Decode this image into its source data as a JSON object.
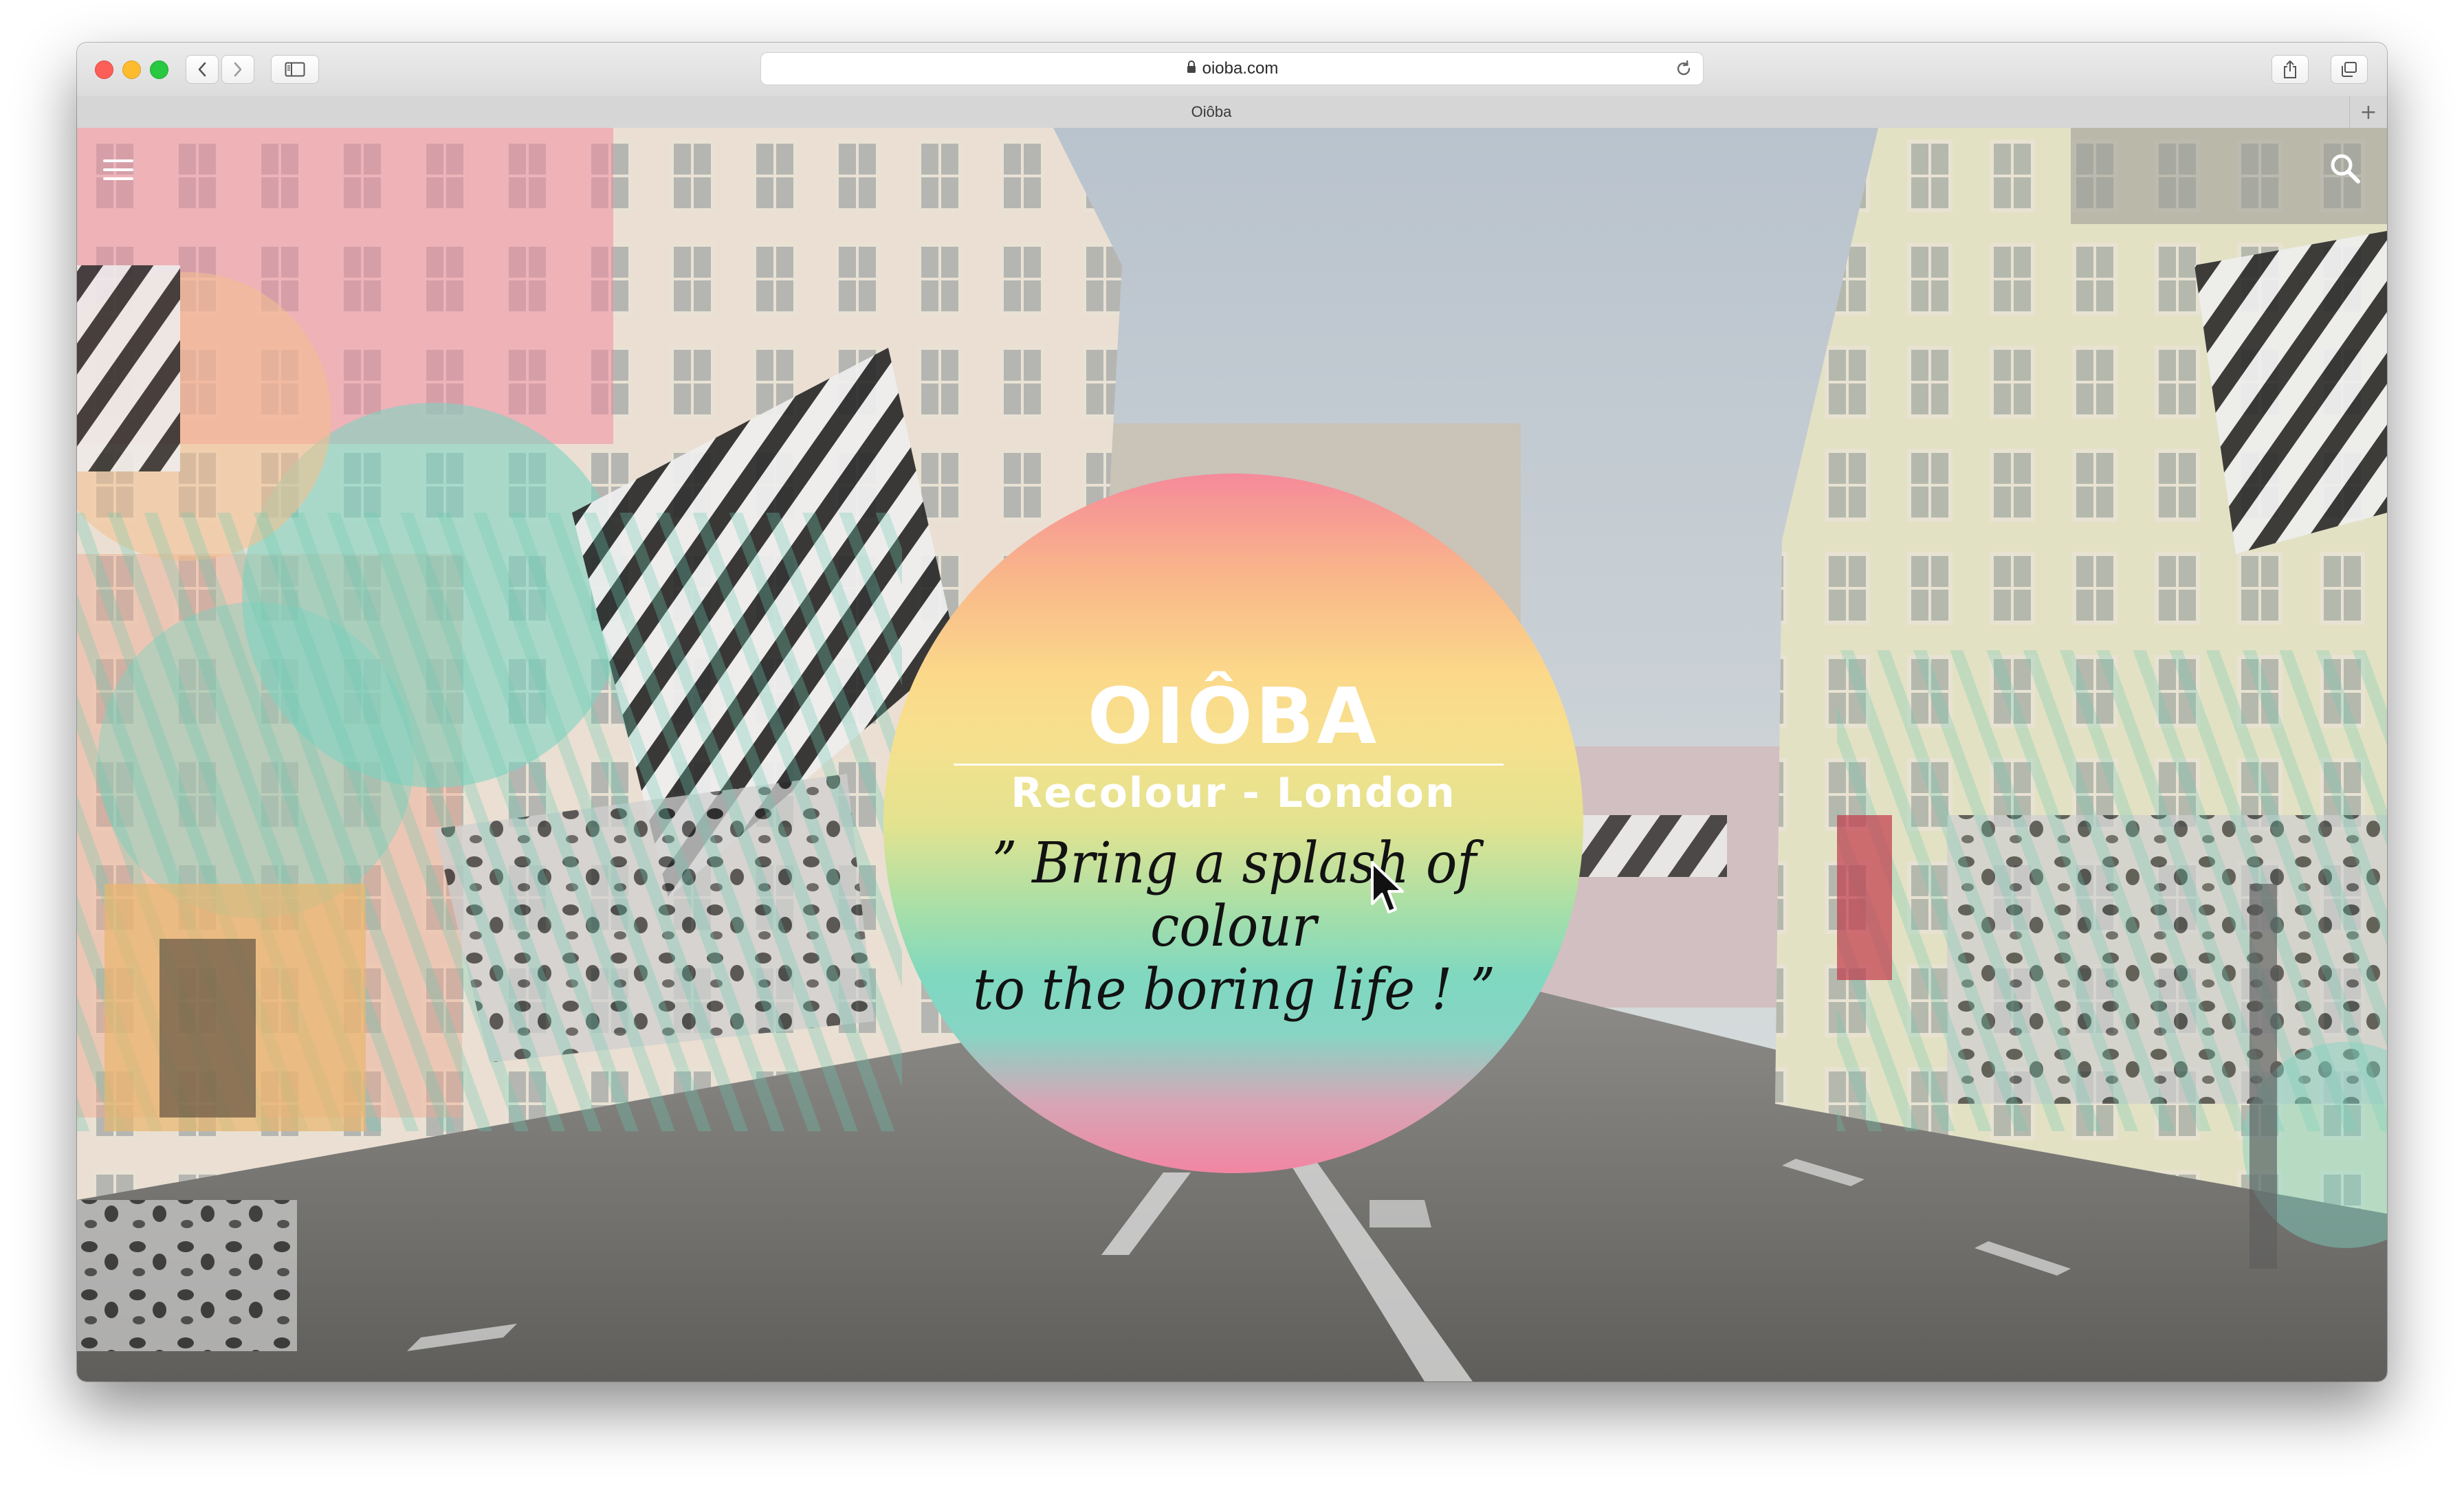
{
  "browser": {
    "url": "oioba.com",
    "tab_title": "Oiôba",
    "new_tab": "+"
  },
  "icons": {
    "back": "chevron-left-icon",
    "forward": "chevron-right-icon",
    "sidebar": "sidebar-icon",
    "lock": "lock-icon",
    "reload": "reload-icon",
    "share": "share-icon",
    "tabs": "tabs-overview-icon",
    "menu": "hamburger-menu-icon",
    "search": "search-icon"
  },
  "hero": {
    "brand": "OIÔBA",
    "subtitle": "Recolour - London",
    "tagline_line1": "ˮ Bring a splash of colour",
    "tagline_line2": "to the boring life ! ˮ"
  },
  "colors": {
    "circle_top": "#f58a9a",
    "circle_mid": "#fbd98a",
    "circle_lower": "#7fd8c0",
    "circle_bottom": "#f285a2"
  }
}
